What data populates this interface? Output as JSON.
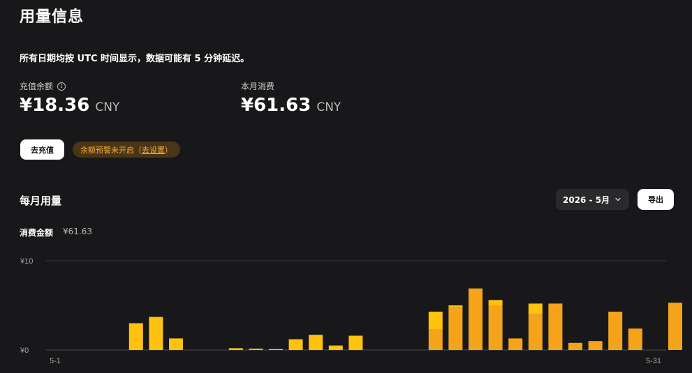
{
  "page": {
    "title": "用量信息",
    "utc_note": "所有日期均按 UTC 时间显示，数据可能有 5 分钟延迟。"
  },
  "balance": {
    "label": "充值余额",
    "amount": "¥18.36",
    "currency": "CNY"
  },
  "monthly_spend": {
    "label": "本月消费",
    "amount": "¥61.63",
    "currency": "CNY"
  },
  "actions": {
    "topup_label": "去充值"
  },
  "alert": {
    "text": "余额预警未开启（",
    "link": "去设置",
    "suffix": "）"
  },
  "section": {
    "title": "每月用量",
    "month_select": "2026 - 5月",
    "export_label": "导出"
  },
  "consumption": {
    "label": "消费金额",
    "value": "¥61.63"
  },
  "colors": {
    "background": "#18181a",
    "bar_bottom": "#f5a31a",
    "bar_top": "#ffc20f",
    "badge_bg": "#4a3516",
    "badge_text": "#f5b13c"
  },
  "chart_data": {
    "type": "bar",
    "stacked": true,
    "x": [
      1,
      2,
      3,
      4,
      5,
      6,
      7,
      8,
      9,
      10,
      11,
      12,
      13,
      14,
      15,
      16,
      17,
      18,
      19,
      20,
      21,
      22,
      23,
      24,
      25,
      26,
      27,
      28,
      29,
      30,
      31
    ],
    "ylim": [
      0,
      10
    ],
    "yticks": [
      "¥0",
      "¥10"
    ],
    "xticks": [
      "5-1",
      "5-31"
    ],
    "grid": true,
    "series": [
      {
        "values": [
          0,
          0,
          0,
          0,
          0,
          0,
          0,
          0,
          0,
          0,
          0,
          0,
          0,
          0,
          0,
          0,
          0,
          0,
          2.3,
          4.8,
          6.9,
          5.0,
          1.3,
          4.0,
          5.2,
          0.8,
          1.0,
          4.3,
          2.4,
          0,
          5.3
        ]
      },
      {
        "values": [
          0,
          0,
          0,
          3.0,
          3.7,
          1.3,
          0,
          0,
          0.2,
          0.15,
          0.1,
          1.2,
          1.7,
          0.5,
          1.6,
          0,
          0,
          0,
          2.0,
          0.2,
          0,
          0.6,
          0,
          1.2,
          0,
          0,
          0,
          0,
          0,
          0,
          0
        ]
      }
    ]
  }
}
